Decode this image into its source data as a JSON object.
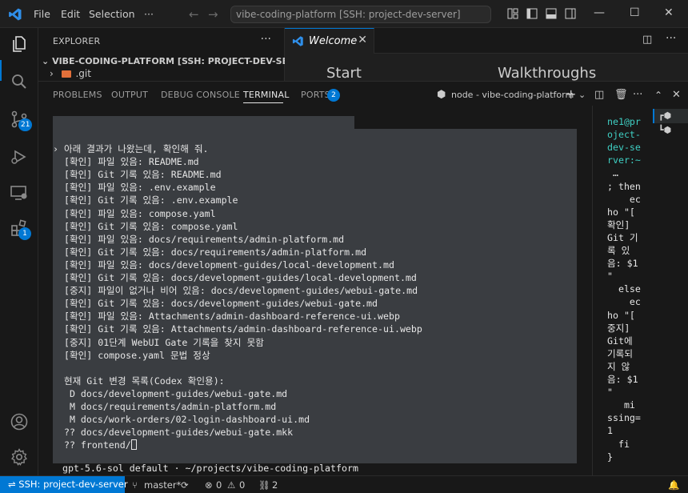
{
  "titlebar": {
    "menu": [
      "File",
      "Edit",
      "Selection",
      "···"
    ],
    "search_text": "vibe-coding-platform [SSH: project-dev-server]"
  },
  "activity": {
    "source_control_badge": "21",
    "extensions_badge": "1"
  },
  "explorer": {
    "title": "EXPLORER",
    "folder": "VIBE-CODING-PLATFORM [SSH: PROJECT-DEV-SERVER]",
    "first_item": ".git"
  },
  "editor": {
    "tab_label": "Welcome",
    "start_heading": "Start",
    "walkthroughs_heading": "Walkthroughs"
  },
  "panel": {
    "tabs": [
      "PROBLEMS",
      "OUTPUT",
      "DEBUG CONSOLE",
      "TERMINAL",
      "PORTS"
    ],
    "ports_badge": "2",
    "terminal_name": "node - vibe-coding-platform"
  },
  "terminal": {
    "lines": [
      "› 아래 결과가 나왔는데, 확인해 줘.",
      "  [확인] 파일 있음: README.md",
      "  [확인] Git 기록 있음: README.md",
      "  [확인] 파일 있음: .env.example",
      "  [확인] Git 기록 있음: .env.example",
      "  [확인] 파일 있음: compose.yaml",
      "  [확인] Git 기록 있음: compose.yaml",
      "  [확인] 파일 있음: docs/requirements/admin-platform.md",
      "  [확인] Git 기록 있음: docs/requirements/admin-platform.md",
      "  [확인] 파일 있음: docs/development-guides/local-development.md",
      "  [확인] Git 기록 있음: docs/development-guides/local-development.md",
      "  [중지] 파일이 없거나 비어 있음: docs/development-guides/webui-gate.md",
      "  [확인] Git 기록 있음: docs/development-guides/webui-gate.md",
      "  [확인] 파일 있음: Attachments/admin-dashboard-reference-ui.webp",
      "  [확인] Git 기록 있음: Attachments/admin-dashboard-reference-ui.webp",
      "  [중지] 01단계 WebUI Gate 기록을 찾지 못함",
      "  [확인] compose.yaml 문법 정상",
      "",
      "  현재 Git 변경 목록(Codex 확인용):",
      "   D docs/development-guides/webui-gate.md",
      "   M docs/requirements/admin-platform.md",
      "   M docs/work-orders/02-login-dashboard-ui.md",
      "  ?? docs/development-guides/webui-gate.mkk",
      "  ?? frontend/"
    ],
    "prompt": "gpt-5.6-sol default · ~/projects/vibe-coding-platform"
  },
  "right_pane": {
    "lines": [
      "ne1@pr",
      "oject-",
      "dev-se",
      "rver:~",
      " …",
      "; then",
      "    ec",
      "ho \"[",
      "확인]",
      "Git 기",
      "록 있",
      "음: $1",
      "\"",
      "  else",
      "    ec",
      "ho \"[",
      "중지]",
      "Git에",
      "기록되",
      "지 않",
      "음: $1",
      "\"",
      "   mi",
      "ssing=",
      "1",
      "  fi",
      "}"
    ],
    "line_colors": [
      "#3fd0c4",
      "#3fd0c4",
      "#3fd0c4",
      "#3fd0c4"
    ]
  },
  "statusbar": {
    "remote": "SSH: project-dev-server",
    "branch": "master*",
    "errors": "0",
    "warnings": "0",
    "ports": "2"
  },
  "colors": {
    "accent": "#0078d4",
    "terminal_bg": "#3a3d41"
  }
}
